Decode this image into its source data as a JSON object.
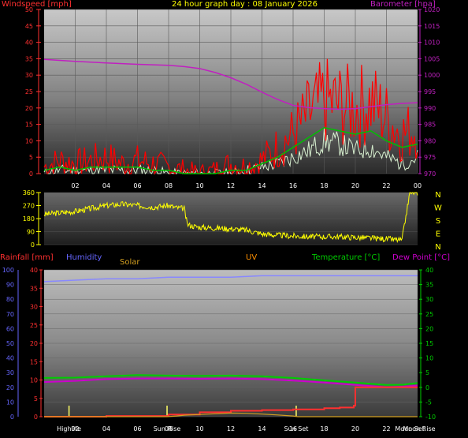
{
  "title": "24 hour graph day : 08 January 2026",
  "colors": {
    "windspeed": "#ff0000",
    "windgust": "#cc0000",
    "windavg": "#00c000",
    "windlight": "#d8f0d0",
    "barometer": "#c020c0",
    "direction": "#ffff00",
    "rain": "#ff3030",
    "humidity": "#8888ff",
    "solar": "#d4a020",
    "uv": "#ff9000",
    "temperature": "#00cc00",
    "dewpoint": "#cc00cc",
    "axis_red": "#ff3030",
    "axis_blue": "#6666ff",
    "axis_green": "#00cc00",
    "axis_magenta": "#cc00cc",
    "axis_yellow": "#ffff00"
  },
  "labels": {
    "windspeed": "Windspeed [mph]",
    "barometer": "Barometer [hpa]",
    "rainfall": "Rainfall [mm]",
    "humidity": "Humidity",
    "solar": "Solar",
    "uv": "UV",
    "temperature": "Temperature [°C]",
    "dewpoint": "Dew Point [°C]"
  },
  "chart_data": [
    {
      "type": "line",
      "id": "wind",
      "title": "24 hour graph day : 08 January 2026",
      "x_ticks": [
        "02",
        "04",
        "06",
        "08",
        "10",
        "12",
        "14",
        "16",
        "18",
        "20",
        "22",
        "00"
      ],
      "xlim_hours": [
        0,
        24
      ],
      "left_axis": {
        "label": "Windspeed [mph]",
        "ticks": [
          0,
          5,
          10,
          15,
          20,
          25,
          30,
          35,
          40,
          45,
          50
        ],
        "ylim": [
          0,
          50
        ]
      },
      "right_axis": {
        "label": "Barometer [hpa]",
        "ticks": [
          970,
          975,
          980,
          985,
          990,
          995,
          1000,
          1005,
          1010,
          1015,
          1020
        ],
        "ylim": [
          970,
          1020
        ]
      },
      "series": [
        {
          "key": "barometer",
          "axis": "right",
          "x": [
            0,
            2,
            4,
            6,
            8,
            9,
            10,
            11,
            12,
            13,
            14,
            15,
            16,
            17,
            18,
            19,
            20,
            21,
            22,
            23,
            24
          ],
          "y": [
            1004.8,
            1004.2,
            1003.7,
            1003.3,
            1003.0,
            1002.6,
            1002.0,
            1000.8,
            999.2,
            997.2,
            994.8,
            992.6,
            990.8,
            990.1,
            989.8,
            989.6,
            989.8,
            990.4,
            991.0,
            991.4,
            991.6
          ]
        },
        {
          "key": "windspeed",
          "axis": "left",
          "x": [
            0,
            1,
            2,
            3,
            4,
            5,
            6,
            7,
            8,
            9,
            10,
            11,
            12,
            13,
            14,
            15,
            16,
            17,
            18,
            19,
            20,
            21,
            22,
            23,
            24
          ],
          "y": [
            2,
            4,
            3,
            4,
            5,
            3,
            4,
            3,
            2,
            1,
            0,
            1,
            3,
            2,
            4,
            8,
            12,
            18,
            22,
            21,
            20,
            22,
            17,
            12,
            14
          ]
        },
        {
          "key": "windavg",
          "axis": "left",
          "x": [
            0,
            1,
            2,
            3,
            4,
            5,
            6,
            7,
            8,
            9,
            10,
            11,
            12,
            13,
            14,
            15,
            16,
            17,
            18,
            19,
            20,
            21,
            22,
            23,
            24
          ],
          "y": [
            1,
            2,
            1,
            2,
            2,
            2,
            2,
            1,
            1,
            0,
            0,
            0,
            1,
            1,
            3,
            5,
            8,
            11,
            14,
            13,
            12,
            13,
            10,
            8,
            9
          ]
        },
        {
          "key": "windlight",
          "axis": "left",
          "x": [
            0,
            1,
            2,
            3,
            4,
            5,
            6,
            7,
            8,
            9,
            10,
            11,
            12,
            13,
            14,
            15,
            16,
            17,
            18,
            19,
            20,
            21,
            22,
            23,
            24
          ],
          "y": [
            0,
            1,
            1,
            1,
            1,
            1,
            1,
            1,
            0,
            0,
            0,
            0,
            0,
            1,
            2,
            3,
            5,
            7,
            10,
            9,
            7,
            8,
            5,
            3,
            5
          ]
        }
      ]
    },
    {
      "type": "line",
      "id": "direction",
      "y_ticks": [
        0,
        90,
        180,
        270,
        360
      ],
      "ylim": [
        0,
        360
      ],
      "compass": [
        "N",
        "W",
        "S",
        "E",
        "N"
      ],
      "series": [
        {
          "key": "direction",
          "x": [
            0,
            1,
            2,
            3,
            4,
            5,
            6,
            7,
            8,
            8.5,
            9,
            9.2,
            9.5,
            10,
            11,
            12,
            13,
            14,
            15,
            16,
            17,
            18,
            19,
            20,
            21,
            22,
            23,
            23.5,
            24
          ],
          "y": [
            210,
            220,
            230,
            250,
            270,
            280,
            270,
            260,
            270,
            255,
            250,
            140,
            130,
            120,
            115,
            110,
            100,
            75,
            65,
            60,
            55,
            55,
            55,
            50,
            45,
            40,
            30,
            360,
            360
          ]
        }
      ]
    },
    {
      "type": "line",
      "id": "climate",
      "x_ticks": [
        "Highlite",
        "02",
        "04",
        "06",
        "Sun Rise",
        "08",
        "10",
        "12",
        "14",
        "Sun Set",
        "16",
        "18",
        "20",
        "22",
        "Moon Set",
        "Moon Rise"
      ],
      "xlim_hours": [
        0,
        24
      ],
      "axes": {
        "humidity": {
          "ticks": [
            0,
            10,
            20,
            30,
            40,
            50,
            60,
            70,
            80,
            90,
            100
          ],
          "ylim": [
            0,
            100
          ]
        },
        "rainfall": {
          "ticks": [
            0,
            5,
            10,
            15,
            20,
            25,
            30,
            35,
            40
          ],
          "ylim": [
            0,
            40
          ]
        },
        "temperature": {
          "ticks": [
            -10,
            -5,
            0,
            5,
            10,
            15,
            20,
            25,
            30,
            35,
            40
          ],
          "ylim": [
            -10,
            40
          ]
        }
      },
      "series": [
        {
          "key": "humidity",
          "axis": "humidity",
          "x": [
            0,
            2,
            4,
            6,
            8,
            10,
            12,
            14,
            16,
            18,
            20,
            22,
            24
          ],
          "y": [
            92,
            93,
            94,
            94,
            95,
            95,
            95,
            96,
            96,
            96,
            96,
            96,
            96
          ]
        },
        {
          "key": "temperature",
          "axis": "temperature",
          "x": [
            0,
            2,
            4,
            6,
            8,
            10,
            12,
            14,
            16,
            18,
            20,
            22,
            23,
            24
          ],
          "y": [
            3.2,
            3.3,
            3.8,
            4.2,
            4.0,
            3.9,
            4.0,
            3.8,
            3.2,
            2.4,
            1.6,
            0.8,
            0.9,
            1.5
          ]
        },
        {
          "key": "dewpoint",
          "axis": "temperature",
          "x": [
            0,
            2,
            4,
            6,
            8,
            10,
            12,
            14,
            16,
            18,
            20,
            22,
            23,
            24
          ],
          "y": [
            1.8,
            2.2,
            2.8,
            3.0,
            3.0,
            2.9,
            3.0,
            2.8,
            2.3,
            1.6,
            0.8,
            0.0,
            0.2,
            0.6
          ]
        },
        {
          "key": "rain",
          "axis": "rainfall",
          "x": [
            0,
            4,
            8,
            10,
            12,
            14,
            16,
            18,
            19,
            19.9,
            20,
            22,
            23.5,
            24
          ],
          "y": [
            0,
            0.2,
            0.6,
            1.2,
            1.6,
            1.8,
            2.0,
            2.3,
            2.5,
            3.0,
            8.0,
            8.0,
            8.0,
            8.0
          ]
        },
        {
          "key": "solar",
          "axis": "humidity",
          "x": [
            0,
            7.9,
            8.5,
            9,
            10,
            11,
            12,
            13,
            14,
            15,
            16,
            16.3,
            24
          ],
          "y": [
            0,
            0,
            0.5,
            1,
            1.5,
            2,
            2.5,
            2.3,
            1.8,
            1.2,
            0.5,
            0,
            0
          ]
        }
      ]
    }
  ]
}
